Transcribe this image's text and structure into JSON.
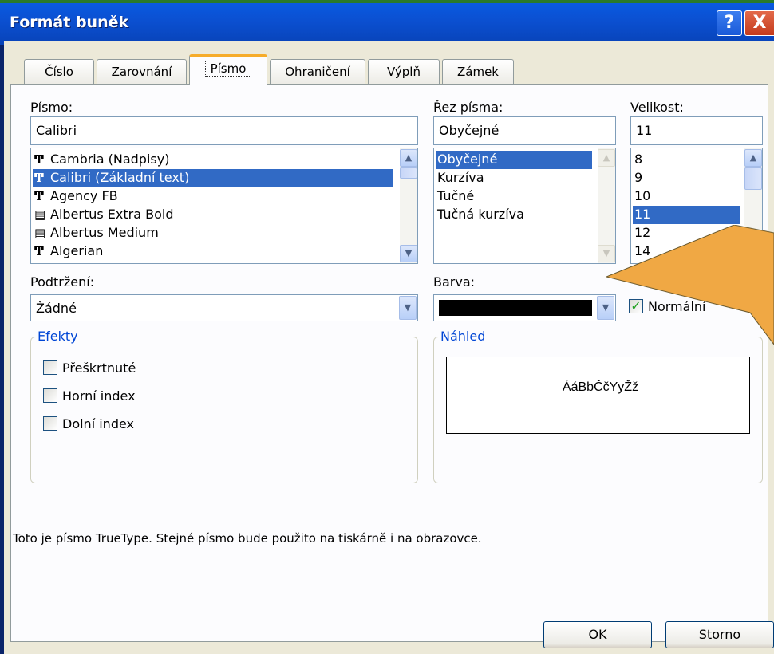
{
  "window": {
    "title": "Formát buněk"
  },
  "titlebar_buttons": {
    "help": "?",
    "close": "X"
  },
  "tabs": [
    {
      "label": "Číslo"
    },
    {
      "label": "Zarovnání"
    },
    {
      "label": "Písmo"
    },
    {
      "label": "Ohraničení"
    },
    {
      "label": "Výplň"
    },
    {
      "label": "Zámek"
    }
  ],
  "font": {
    "label": "Písmo:",
    "value": "Calibri",
    "items": [
      {
        "icon": "truetype-icon",
        "label": "Cambria (Nadpisy)"
      },
      {
        "icon": "truetype-icon",
        "label": "Calibri (Základní text)"
      },
      {
        "icon": "truetype-icon",
        "label": "Agency FB"
      },
      {
        "icon": "printer-font-icon",
        "label": "Albertus Extra Bold"
      },
      {
        "icon": "printer-font-icon",
        "label": "Albertus Medium"
      },
      {
        "icon": "truetype-icon",
        "label": "Algerian"
      }
    ],
    "selected": "Calibri (Základní text)"
  },
  "style": {
    "label": "Řez písma:",
    "value": "Obyčejné",
    "items": [
      "Obyčejné",
      "Kurzíva",
      "Tučné",
      "Tučná kurzíva"
    ],
    "selected": "Obyčejné"
  },
  "size": {
    "label": "Velikost:",
    "value": "11",
    "items": [
      "8",
      "9",
      "10",
      "11",
      "12",
      "14"
    ],
    "selected": "11"
  },
  "underline": {
    "label": "Podtržení:",
    "value": "Žádné"
  },
  "color": {
    "label": "Barva:",
    "value": "#000000",
    "normal_label": "Normální",
    "normal_checked": true
  },
  "effects": {
    "title": "Efekty",
    "strikethrough": "Přeškrtnuté",
    "superscript": "Horní index",
    "subscript": "Dolní index"
  },
  "preview": {
    "title": "Náhled",
    "sample": "ÁáBbČčYyŽž"
  },
  "info_text": "Toto je písmo TrueType. Stejné písmo bude použito na tiskárně i na obrazovce.",
  "buttons": {
    "ok": "OK",
    "cancel": "Storno"
  },
  "colors": {
    "accent_arrow": "#f0a844",
    "selection": "#316ac5",
    "titlebar": "#0b4fd0"
  }
}
